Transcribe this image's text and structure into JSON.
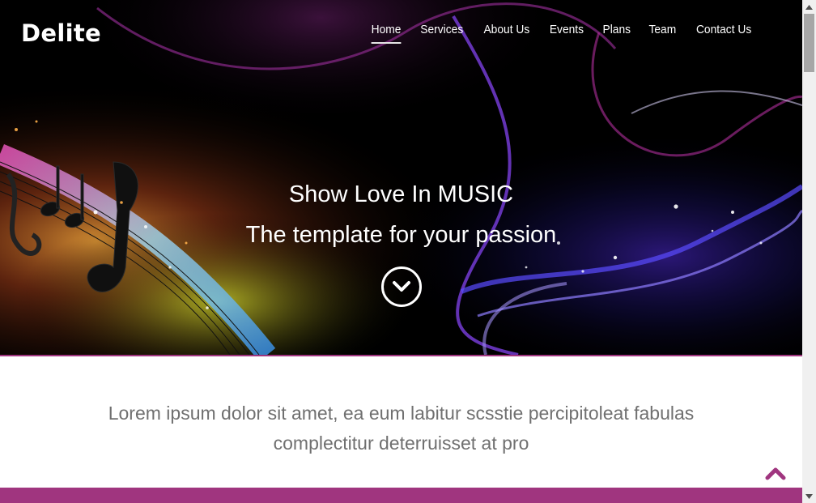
{
  "brand": {
    "name": "Delite"
  },
  "nav": {
    "items": [
      {
        "label": "Home",
        "active": true
      },
      {
        "label": "Services",
        "active": false
      },
      {
        "label": "About Us",
        "active": false
      },
      {
        "label": "Events",
        "active": false
      },
      {
        "label": "Plans",
        "active": false
      },
      {
        "label": "Team",
        "active": false
      },
      {
        "label": "Contact Us",
        "active": false
      }
    ]
  },
  "hero": {
    "headline": "Show Love In MUSIC",
    "subheadline": "The template for your passion",
    "scroll_icon": "chevron-down-circle-icon"
  },
  "intro": {
    "text": "Lorem ipsum dolor sit amet, ea eum labitur scsstie percipitoleat fabulas complectitur deterruisset at pro"
  },
  "footer": {
    "back_to_top_icon": "chevron-up-icon"
  },
  "colors": {
    "accent": "#a0357f",
    "hero_bg": "#000000",
    "intro_text": "#707070"
  }
}
